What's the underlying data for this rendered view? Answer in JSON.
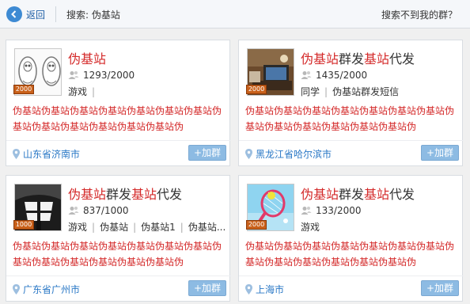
{
  "topbar": {
    "back_label": "返回",
    "search_text": "搜索: 伪基站",
    "not_found": "搜索不到我的群？"
  },
  "add_label": "+加群",
  "cards": [
    {
      "name": [
        "伪基站"
      ],
      "cap": "2000",
      "members": "1293/2000",
      "tags": [
        "游戏"
      ],
      "trailing_sep": true,
      "desc": "伪基站伪基站伪基站伪基站伪基站伪基站伪基站伪基站伪基站伪基站伪基站伪基站伪基站伪",
      "location": "山东省济南市"
    },
    {
      "name": [
        "伪基站",
        "群发",
        "基站",
        "代发"
      ],
      "cap": "2000",
      "members": "1435/2000",
      "tags": [
        "同学",
        "伪基站群发短信"
      ],
      "trailing_sep": false,
      "desc": "伪基站伪基站伪基站伪基站伪基站伪基站伪基站伪基站伪基站伪基站伪基站伪基站伪基站伪",
      "location": "黑龙江省哈尔滨市"
    },
    {
      "name": [
        "伪基站",
        "群发",
        "基站",
        "代发"
      ],
      "cap": "1000",
      "members": "837/1000",
      "tags": [
        "游戏",
        "伪基站",
        "伪基站1",
        "伪基站..."
      ],
      "trailing_sep": false,
      "desc": "伪基站伪基站伪基站伪基站伪基站伪基站伪基站伪基站伪基站伪基站伪基站伪基站伪基站伪",
      "location": "广东省广州市"
    },
    {
      "name": [
        "伪基站",
        "群发",
        "基站",
        "代发"
      ],
      "cap": "2000",
      "members": "133/2000",
      "tags": [
        "游戏"
      ],
      "trailing_sep": false,
      "desc": "伪基站伪基站伪基站伪基站伪基站伪基站伪基站伪基站伪基站伪基站伪基站伪基站伪基站伪",
      "location": "上海市"
    }
  ],
  "icons": {
    "back": "back-arrow-icon",
    "members": "people-icon",
    "location": "location-pin-icon"
  },
  "colors": {
    "highlight": "#d42a2a",
    "link": "#2a78c6",
    "add_button": "#8dbbe3"
  }
}
